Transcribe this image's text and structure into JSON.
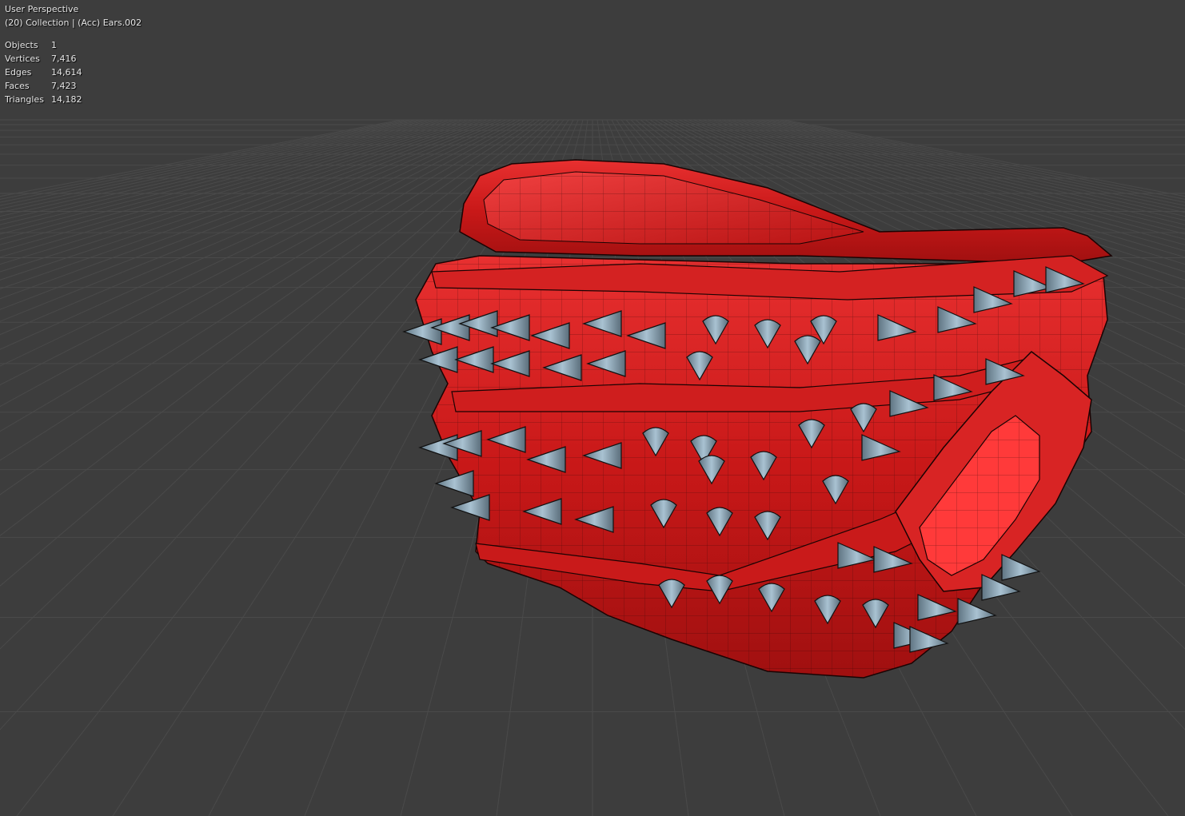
{
  "viewport": {
    "view_name": "User Perspective",
    "collection_line": "(20) Collection | (Acc) Ears.002",
    "background_color": "#3d3d3d",
    "grid_color": "#4a4a4a",
    "model_color": "#d91f1f",
    "spike_color": "#8fa8b8"
  },
  "stats": [
    {
      "label": "Objects",
      "value": "1"
    },
    {
      "label": "Vertices",
      "value": "7,416"
    },
    {
      "label": "Edges",
      "value": "14,614"
    },
    {
      "label": "Faces",
      "value": "7,423"
    },
    {
      "label": "Triangles",
      "value": "14,182"
    }
  ]
}
